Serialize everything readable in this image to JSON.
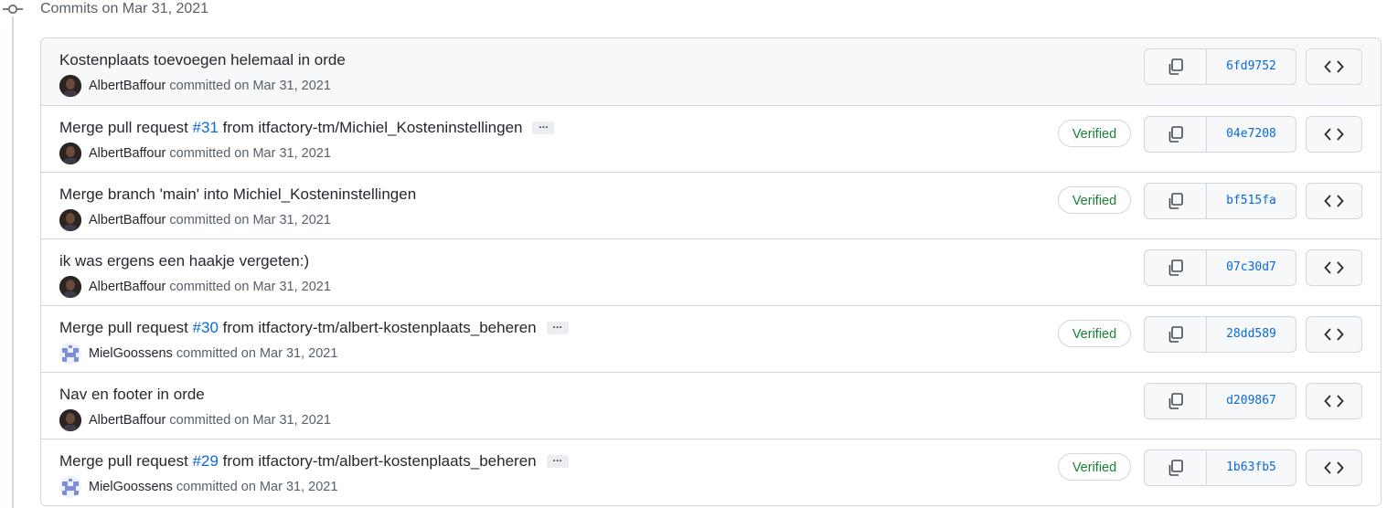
{
  "group": {
    "title": "Commits on Mar 31, 2021"
  },
  "commits": [
    {
      "title_prefix": "Kostenplaats toevoegen helemaal in orde",
      "pr": "",
      "title_suffix": "",
      "has_ellipsis": false,
      "author": "AlbertBaffour",
      "avatar": "photo",
      "committed_text": "committed on Mar 31, 2021",
      "verified": "",
      "sha": "6fd9752"
    },
    {
      "title_prefix": "Merge pull request ",
      "pr": "#31",
      "title_suffix": " from itfactory-tm/Michiel_Kosteninstellingen",
      "has_ellipsis": true,
      "author": "AlbertBaffour",
      "avatar": "photo",
      "committed_text": "committed on Mar 31, 2021",
      "verified": "Verified",
      "sha": "04e7208"
    },
    {
      "title_prefix": "Merge branch 'main' into Michiel_Kosteninstellingen",
      "pr": "",
      "title_suffix": "",
      "has_ellipsis": false,
      "author": "AlbertBaffour",
      "avatar": "photo",
      "committed_text": "committed on Mar 31, 2021",
      "verified": "Verified",
      "sha": "bf515fa"
    },
    {
      "title_prefix": "ik was ergens een haakje vergeten:)",
      "pr": "",
      "title_suffix": "",
      "has_ellipsis": false,
      "author": "AlbertBaffour",
      "avatar": "photo",
      "committed_text": "committed on Mar 31, 2021",
      "verified": "",
      "sha": "07c30d7"
    },
    {
      "title_prefix": "Merge pull request ",
      "pr": "#30",
      "title_suffix": " from itfactory-tm/albert-kostenplaats_beheren",
      "has_ellipsis": true,
      "author": "MielGoossens",
      "avatar": "identicon",
      "committed_text": "committed on Mar 31, 2021",
      "verified": "Verified",
      "sha": "28dd589"
    },
    {
      "title_prefix": "Nav en footer in orde",
      "pr": "",
      "title_suffix": "",
      "has_ellipsis": false,
      "author": "AlbertBaffour",
      "avatar": "photo",
      "committed_text": "committed on Mar 31, 2021",
      "verified": "",
      "sha": "d209867"
    },
    {
      "title_prefix": "Merge pull request ",
      "pr": "#29",
      "title_suffix": " from itfactory-tm/albert-kostenplaats_beheren",
      "has_ellipsis": true,
      "author": "MielGoossens",
      "avatar": "identicon",
      "committed_text": "committed on Mar 31, 2021",
      "verified": "Verified",
      "sha": "1b63fb5"
    }
  ],
  "icons": {
    "timeline": "git-commit-icon",
    "copy": "copy-icon",
    "browse": "code-icon",
    "ellipsis": "ellipsis-icon"
  },
  "colors": {
    "link": "#0969da",
    "verified": "#1a7f37",
    "border": "#d0d7de"
  },
  "ellipsis_label": "…"
}
